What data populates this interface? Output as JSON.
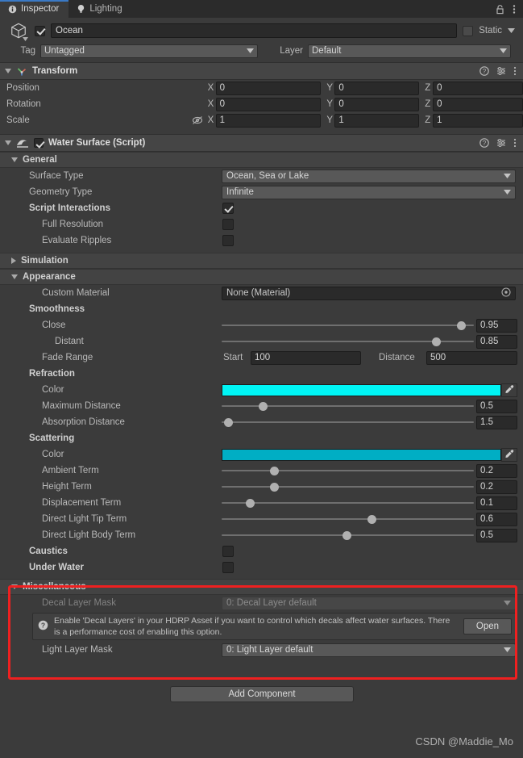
{
  "window": {
    "tabs": [
      {
        "label": "Inspector",
        "icon": "info-icon",
        "active": true
      },
      {
        "label": "Lighting",
        "icon": "light-bulb-icon",
        "active": false
      }
    ],
    "lock_icon": "lock-icon",
    "menu_icon": "kebab-menu-icon"
  },
  "gameobject": {
    "icon": "prefab-cube-icon",
    "enabled": true,
    "name": "Ocean",
    "static_label": "Static",
    "static_checked": false,
    "tag_label": "Tag",
    "tag_value": "Untagged",
    "layer_label": "Layer",
    "layer_value": "Default"
  },
  "transform": {
    "title": "Transform",
    "icon": "transform-axes-icon",
    "expanded": true,
    "rows": [
      {
        "label": "Position",
        "x": "0",
        "y": "0",
        "z": "0",
        "locked_icon": false
      },
      {
        "label": "Rotation",
        "x": "0",
        "y": "0",
        "z": "0",
        "locked_icon": false
      },
      {
        "label": "Scale",
        "x": "1",
        "y": "1",
        "z": "1",
        "locked_icon": true
      }
    ],
    "axes": [
      "X",
      "Y",
      "Z"
    ],
    "help_icon": "help-icon",
    "preset_icon": "preset-icon",
    "menu_icon": "kebab-menu-icon"
  },
  "water_surface": {
    "title": "Water Surface (Script)",
    "icon": "wave-icon",
    "enabled": true,
    "help_icon": "help-icon",
    "preset_icon": "preset-icon",
    "menu_icon": "kebab-menu-icon",
    "sections": {
      "general": {
        "title": "General",
        "expanded": true,
        "surface_type_label": "Surface Type",
        "surface_type_value": "Ocean, Sea or Lake",
        "geometry_type_label": "Geometry Type",
        "geometry_type_value": "Infinite",
        "script_interactions_label": "Script Interactions",
        "script_interactions_checked": true,
        "full_resolution_label": "Full Resolution",
        "full_resolution_checked": false,
        "evaluate_ripples_label": "Evaluate Ripples",
        "evaluate_ripples_checked": false
      },
      "simulation": {
        "title": "Simulation",
        "expanded": false
      },
      "appearance": {
        "title": "Appearance",
        "expanded": true,
        "custom_material_label": "Custom Material",
        "custom_material_value": "None (Material)",
        "smoothness_label": "Smoothness",
        "close_label": "Close",
        "close_value": "0.95",
        "distant_label": "Distant",
        "distant_value": "0.85",
        "fade_range_label": "Fade Range",
        "start_label": "Start",
        "start_value": "100",
        "distance_label": "Distance",
        "distance_value": "500",
        "refraction_label": "Refraction",
        "refraction_color_label": "Color",
        "refraction_color": "#00f5f5",
        "maximum_distance_label": "Maximum Distance",
        "maximum_distance_value": "0.5",
        "absorption_distance_label": "Absorption Distance",
        "absorption_distance_value": "1.5",
        "scattering_label": "Scattering",
        "scattering_color_label": "Color",
        "scattering_color": "#00aec4",
        "ambient_term_label": "Ambient Term",
        "ambient_term_value": "0.2",
        "height_term_label": "Height Term",
        "height_term_value": "0.2",
        "displacement_term_label": "Displacement Term",
        "displacement_term_value": "0.1",
        "direct_light_tip_label": "Direct Light Tip Term",
        "direct_light_tip_value": "0.6",
        "direct_light_body_label": "Direct Light Body Term",
        "direct_light_body_value": "0.5",
        "caustics_label": "Caustics",
        "caustics_checked": false,
        "under_water_label": "Under Water",
        "under_water_checked": false,
        "eyedropper_icon": "eyedropper-icon"
      },
      "miscellaneous": {
        "title": "Miscellaneous",
        "expanded": true,
        "highlight_color": "#ef2020",
        "decal_layer_mask_label": "Decal Layer Mask",
        "decal_layer_mask_value": "0: Decal Layer default",
        "decal_layer_mask_disabled": true,
        "help_icon": "help-circle-icon",
        "help_text": "Enable 'Decal Layers' in your HDRP Asset if you want to control which decals affect water surfaces. There is a performance cost of enabling this option.",
        "open_button_label": "Open",
        "light_layer_mask_label": "Light Layer Mask",
        "light_layer_mask_value": "0: Light Layer default"
      }
    }
  },
  "footer": {
    "add_component_label": "Add Component",
    "watermark": "CSDN @Maddie_Mo"
  },
  "slider_positions": {
    "close": 0.95,
    "distant": 0.85,
    "maximum_distance": 0.165,
    "absorption_distance": 0.028,
    "ambient_term": 0.21,
    "height_term": 0.21,
    "displacement_term": 0.115,
    "direct_light_tip": 0.595,
    "direct_light_body": 0.497
  }
}
